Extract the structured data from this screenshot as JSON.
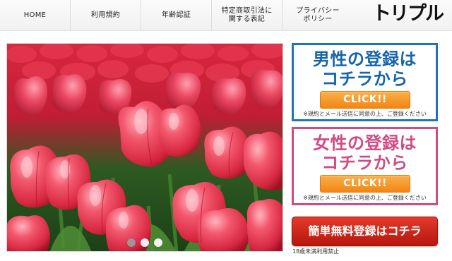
{
  "nav": {
    "items": [
      {
        "label": "HOME"
      },
      {
        "label": "利用規約"
      },
      {
        "label": "年齢認証"
      },
      {
        "label": "特定商取引法に\n関する表記"
      },
      {
        "label": "プライバシー\nポリシー"
      }
    ]
  },
  "logo": {
    "text": "トリプル"
  },
  "slider": {
    "image": "red-tulip-field",
    "dot_count": 3,
    "active_dot": 1
  },
  "male_box": {
    "title": "男性の登録は\nコチラから",
    "button": "CLICK!!",
    "note": "※規約とメール送信に同意の上、ご登録ください",
    "color": "#1565a8"
  },
  "female_box": {
    "title": "女性の登録は\nコチラから",
    "button": "CLICK!!",
    "note": "※規約とメール送信に同意の上、ご登録ください",
    "color": "#d04a83"
  },
  "easy_register": {
    "label": "簡単無料登録はコチラ",
    "color": "#c81f12"
  },
  "age_note": "18歳未満利用禁止"
}
